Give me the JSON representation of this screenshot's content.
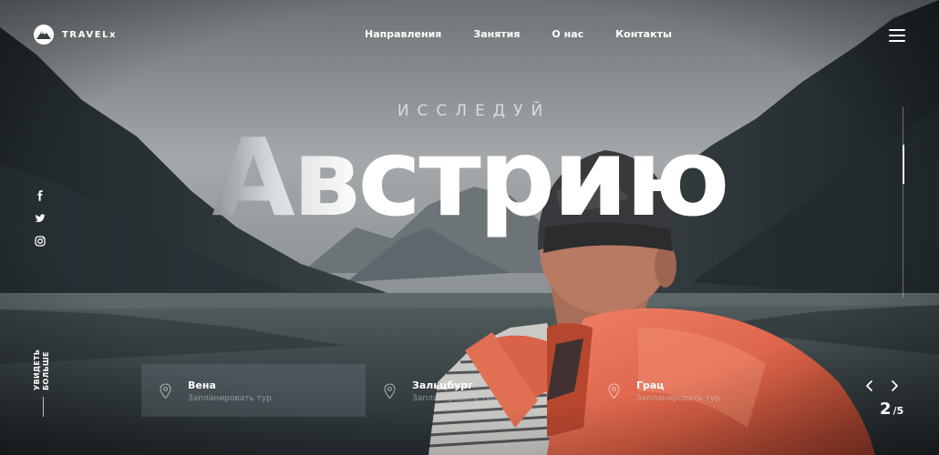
{
  "brand": {
    "name": "TRAVELx",
    "logo_icon": "mountain-icon"
  },
  "nav": {
    "items": [
      "Направления",
      "Занятия",
      "О нас",
      "Контакты"
    ]
  },
  "menu_icon": "hamburger-menu-icon",
  "hero": {
    "kicker": "ИССЛЕДУЙ",
    "title": "Австрию"
  },
  "social": [
    "facebook-icon",
    "twitter-icon",
    "instagram-icon"
  ],
  "scroll_more": {
    "line1": "УВИДЕТЬ",
    "line2": "БОЛЬШЕ"
  },
  "destinations": [
    {
      "title": "Вена",
      "subtitle": "Запланировать тур",
      "icon": "location-pin-icon"
    },
    {
      "title": "Зальцбург",
      "subtitle": "Запланировать тур",
      "icon": "location-pin-icon"
    },
    {
      "title": "Грац",
      "subtitle": "Запланировать тур",
      "icon": "location-pin-icon"
    }
  ],
  "slider": {
    "current": "2",
    "separator": "/",
    "total": "5",
    "progress": 0.4
  },
  "colors": {
    "backpack": "#e2694c",
    "sky": "#9ea3a6",
    "mountains": "#2b3236",
    "lake": "#4a5357"
  }
}
